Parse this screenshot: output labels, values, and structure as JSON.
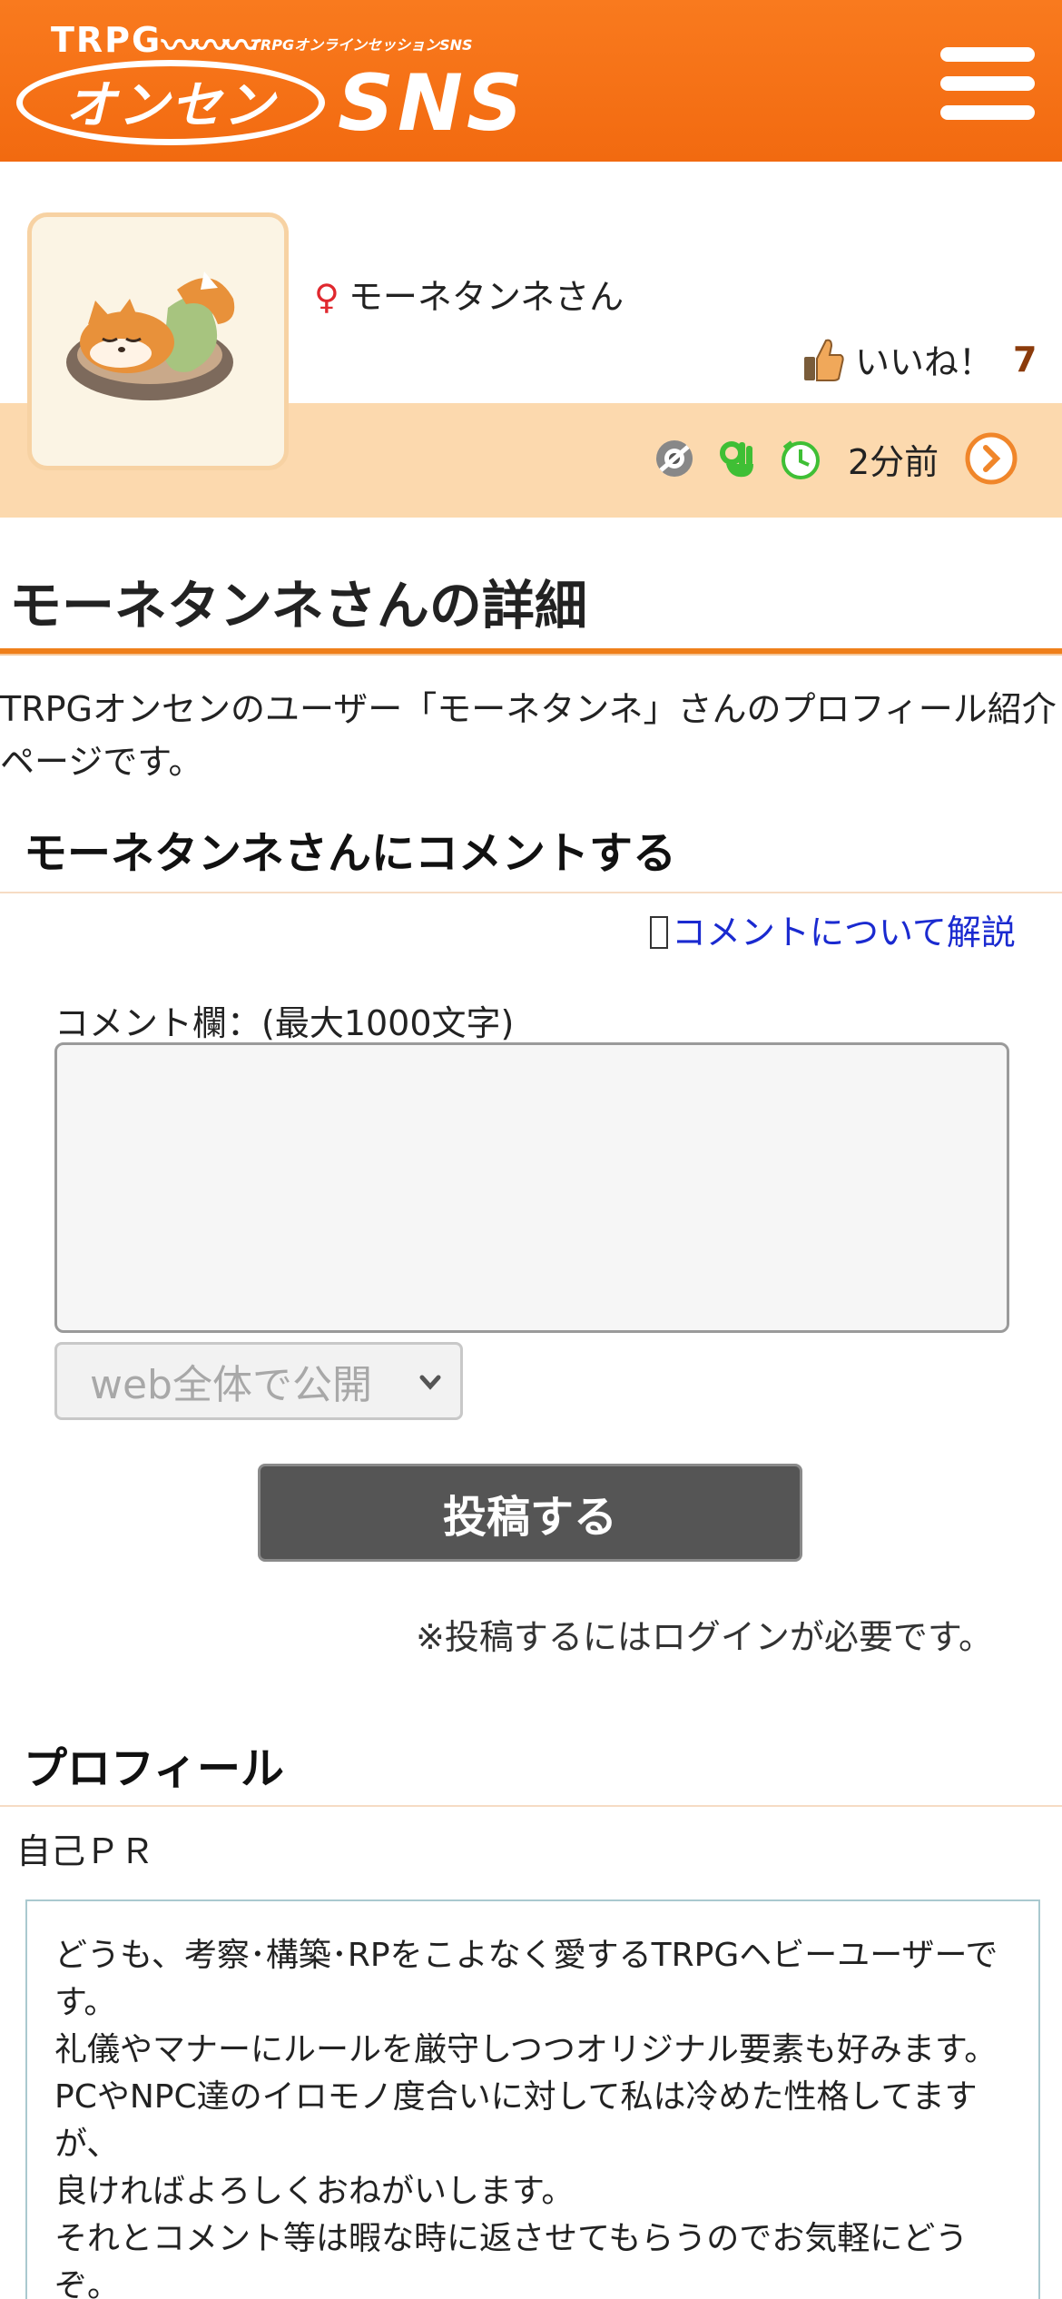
{
  "header": {
    "logo_trpg": "TRPG",
    "logo_tagline": "TRPGオンラインセッションSNS",
    "logo_main": "オンセン",
    "logo_sns": "SNS"
  },
  "profile_card": {
    "gender_symbol": "♀",
    "user_name": "モーネタンネさん",
    "like_label": "いいね！",
    "like_count": "7",
    "last_active": "2分前"
  },
  "page": {
    "title": "モーネタンネさんの詳細",
    "intro": "TRPGオンセンのユーザー「モーネタンネ」さんのプロフィール紹介ページです。"
  },
  "comment_section": {
    "heading": "モーネタンネさんにコメントする",
    "help_link": "コメントについて解説",
    "field_label": "コメント欄：(最大1000文字)",
    "comment_value": "",
    "visibility_selected": "web全体で公開",
    "post_button": "投稿する",
    "login_note": "※投稿するにはログインが必要です。"
  },
  "profile_section": {
    "heading": "プロフィール",
    "self_pr_label": "自己ＰＲ",
    "self_pr_text": "どうも、考察･構築･RPをこよなく愛するTRPGヘビーユーザーです。\n礼儀やマナーにルールを厳守しつつオリジナル要素も好みます。\nPCやNPC達のイロモノ度合いに対して私は冷めた性格してますが、\n良ければよろしくおねがいします。\nそれとコメント等は暇な時に返させてもらうのでお気軽にどうぞ。"
  },
  "colors": {
    "header_orange": "#f5711a",
    "card_band": "#fcd9ae",
    "link_blue": "#1a2ad0",
    "like_count": "#8b3b0b"
  },
  "icons": [
    "hamburger-menu-icon",
    "thumbs-up-icon",
    "camera-icon",
    "ok-hand-icon",
    "clock-icon",
    "arrow-right-circle-icon",
    "chevron-down-icon"
  ]
}
